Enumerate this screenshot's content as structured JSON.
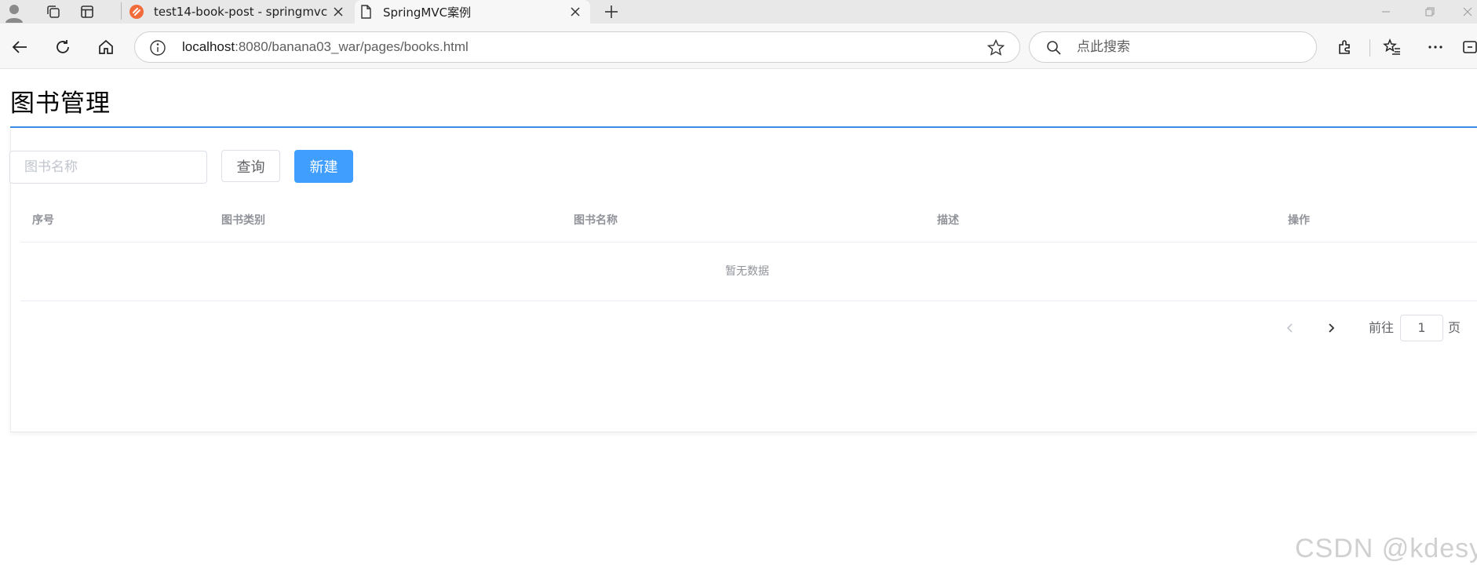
{
  "browser": {
    "tabs": [
      {
        "title": "test14-book-post - springmvc",
        "active": false
      },
      {
        "title": "SpringMVC案例",
        "active": true
      }
    ],
    "address": {
      "host": "localhost",
      "rest": ":8080/banana03_war/pages/books.html"
    },
    "search_placeholder": "点此搜索"
  },
  "page": {
    "title": "图书管理",
    "query_placeholder": "图书名称",
    "query_button": "查询",
    "new_button": "新建",
    "table": {
      "columns": [
        "序号",
        "图书类别",
        "图书名称",
        "描述",
        "操作"
      ],
      "empty_text": "暂无数据"
    },
    "pagination": {
      "goto_label": "前往",
      "page_value": "1",
      "page_suffix": "页"
    }
  },
  "watermark": "CSDN @kdesy",
  "colors": {
    "primary": "#409eff",
    "title_rule": "#3a8ee6",
    "header_text": "#909399"
  },
  "icons": [
    "profile-icon",
    "workspaces-icon",
    "tab-actions-icon",
    "reload-icon",
    "home-icon",
    "back-icon",
    "info-icon",
    "star-icon",
    "search-icon",
    "extensions-icon",
    "favorites-icon",
    "more-icon",
    "chevron-left-icon",
    "chevron-right-icon"
  ]
}
